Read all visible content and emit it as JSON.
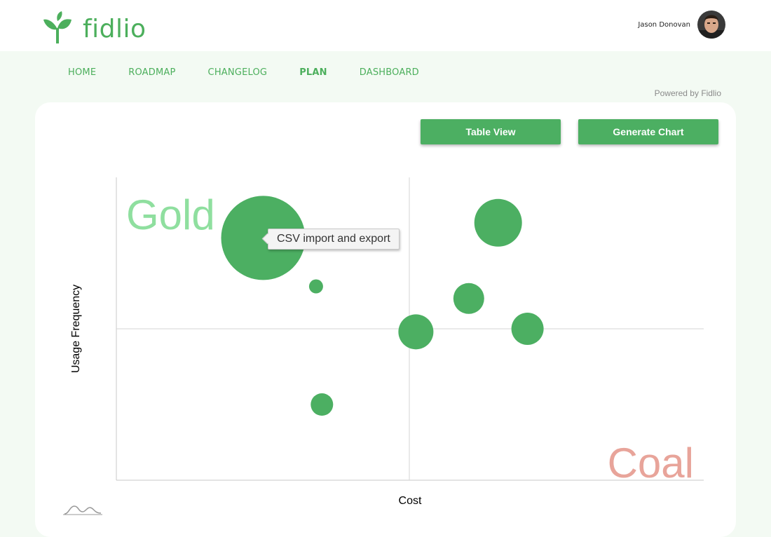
{
  "brand": {
    "name": "fidlio",
    "accent": "#4caf5c"
  },
  "user": {
    "name": "Jason Donovan"
  },
  "nav": [
    {
      "label": "HOME",
      "active": false
    },
    {
      "label": "ROADMAP",
      "active": false
    },
    {
      "label": "CHANGELOG",
      "active": false
    },
    {
      "label": "PLAN",
      "active": true
    },
    {
      "label": "DASHBOARD",
      "active": false
    }
  ],
  "powered_by": "Powered by Fidlio",
  "buttons": {
    "table_view": "Table View",
    "generate_chart": "Generate Chart"
  },
  "tooltip": {
    "text": "CSV import and export"
  },
  "chart_data": {
    "type": "scatter",
    "xlabel": "Cost",
    "ylabel": "Usage Frequency",
    "quadrant_labels": {
      "gold": {
        "text": "Gold",
        "color": "#8fdf9f"
      },
      "coal": {
        "text": "Coal",
        "color": "#e8a49a"
      }
    },
    "bubble_color": "#4caf62",
    "x_range": [
      0,
      100
    ],
    "y_range": [
      0,
      100
    ],
    "points": [
      {
        "name": "CSV import and export",
        "x": 25,
        "y": 80,
        "size": 60
      },
      {
        "x": 34,
        "y": 64,
        "size": 10
      },
      {
        "x": 35,
        "y": 25,
        "size": 16
      },
      {
        "x": 51,
        "y": 49,
        "size": 25
      },
      {
        "x": 60,
        "y": 60,
        "size": 22
      },
      {
        "x": 65,
        "y": 85,
        "size": 34
      },
      {
        "x": 70,
        "y": 50,
        "size": 23
      }
    ]
  }
}
